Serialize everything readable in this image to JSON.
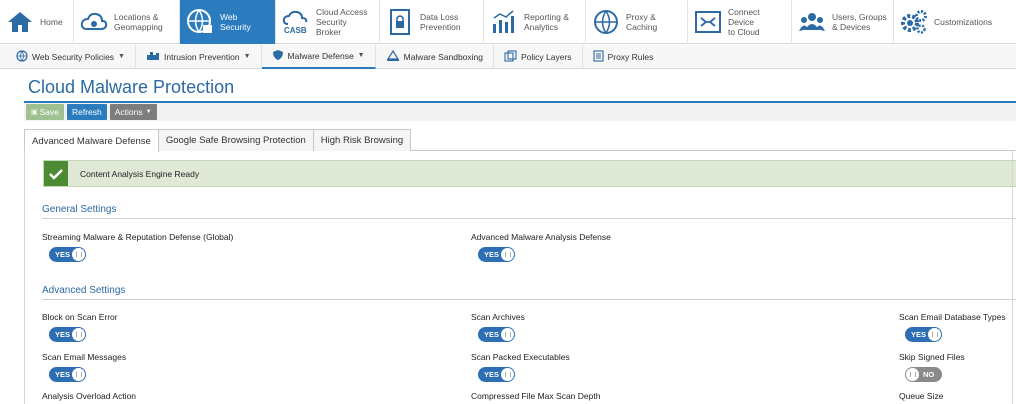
{
  "topnav": [
    {
      "label": "Home",
      "icon": "home-icon"
    },
    {
      "label": "Locations &\nGeomapping",
      "icon": "cloud-location-icon"
    },
    {
      "label": "Web Security",
      "icon": "globe-lock-icon",
      "active": true
    },
    {
      "label": "Cloud Access\nSecurity Broker",
      "icon": "casb-icon"
    },
    {
      "label": "Data Loss\nPrevention",
      "icon": "lock-document-icon"
    },
    {
      "label": "Reporting &\nAnalytics",
      "icon": "chart-icon"
    },
    {
      "label": "Proxy &\nCaching",
      "icon": "globe-icon"
    },
    {
      "label": "Connect Device\nto Cloud",
      "icon": "connect-icon"
    },
    {
      "label": "Users, Groups\n& Devices",
      "icon": "users-icon"
    },
    {
      "label": "Customizations",
      "icon": "gears-icon"
    }
  ],
  "subnav": [
    {
      "label": "Web Security Policies",
      "icon": "globe-icon",
      "dropdown": true
    },
    {
      "label": "Intrusion Prevention",
      "icon": "ips-icon",
      "dropdown": true
    },
    {
      "label": "Malware Defense",
      "icon": "shield-icon",
      "dropdown": true,
      "active": true
    },
    {
      "label": "Malware Sandboxing",
      "icon": "sandbox-icon",
      "dropdown": false
    },
    {
      "label": "Policy Layers",
      "icon": "layers-icon",
      "dropdown": false
    },
    {
      "label": "Proxy Rules",
      "icon": "rules-icon",
      "dropdown": false
    }
  ],
  "page": {
    "title": "Cloud Malware Protection"
  },
  "toolbar": {
    "save_label": "Save",
    "refresh_label": "Refresh",
    "actions_label": "Actions"
  },
  "tabs": [
    {
      "label": "Advanced Malware Defense",
      "active": true
    },
    {
      "label": "Google Safe Browsing Protection"
    },
    {
      "label": "High Risk Browsing"
    }
  ],
  "banner": {
    "text": "Content Analysis Engine Ready",
    "color": "#4c8a33"
  },
  "general": {
    "heading": "General Settings",
    "streaming_label": "Streaming Malware & Reputation Defense (Global)",
    "streaming_state": "YES",
    "advanced_label": "Advanced Malware Analysis Defense",
    "advanced_state": "YES"
  },
  "advanced": {
    "heading": "Advanced Settings",
    "block_scan_error_label": "Block on Scan Error",
    "block_scan_error_state": "YES",
    "scan_archives_label": "Scan Archives",
    "scan_archives_state": "YES",
    "scan_email_db_label": "Scan Email Database Types",
    "scan_email_db_state": "YES",
    "scan_email_messages_label": "Scan Email Messages",
    "scan_email_messages_state": "YES",
    "scan_packed_label": "Scan Packed Executables",
    "scan_packed_state": "YES",
    "skip_signed_label": "Skip Signed Files",
    "skip_signed_state": "NO",
    "overload_label": "Analysis Overload Action",
    "compressed_depth_label": "Compressed File Max Scan Depth",
    "queue_size_label": "Queue Size"
  },
  "colors": {
    "accent": "#2b7bbf",
    "toggle_on": "#2e6eb5",
    "toggle_off": "#8a8a8a"
  }
}
